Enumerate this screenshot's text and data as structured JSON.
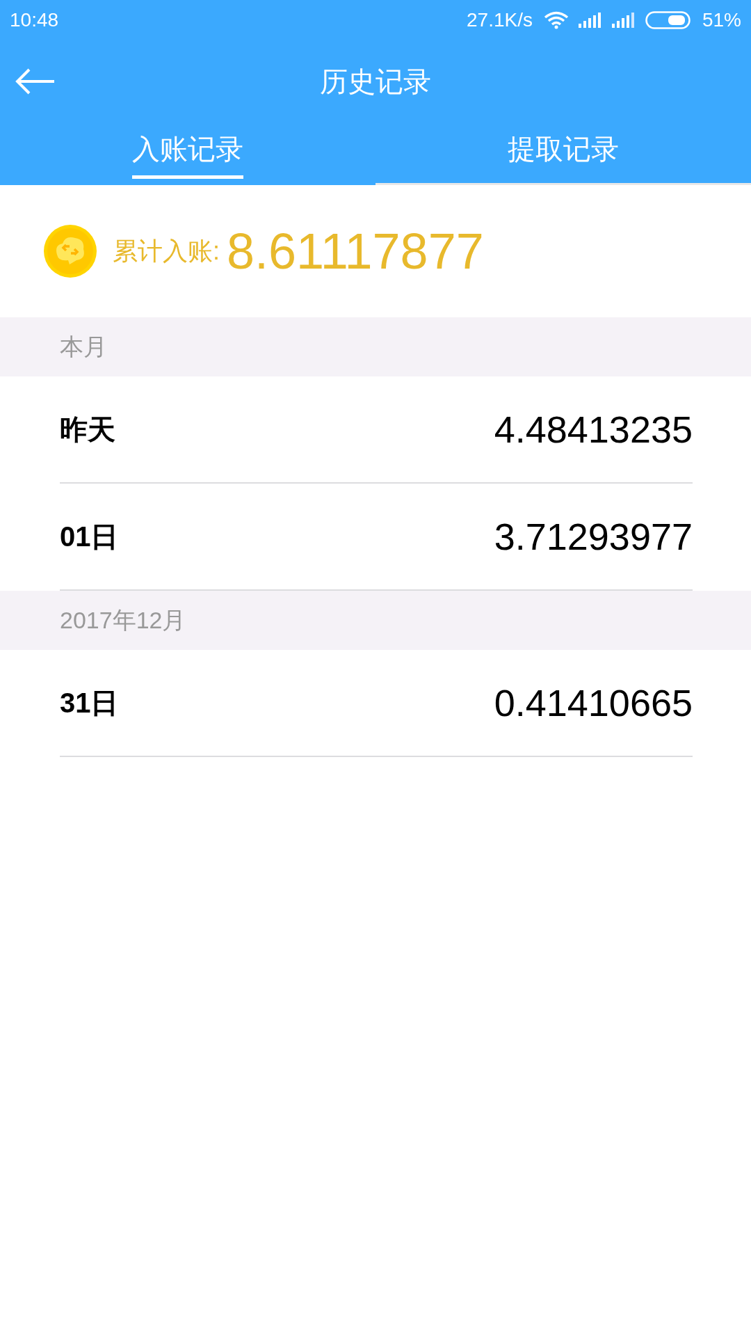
{
  "status_bar": {
    "time": "10:48",
    "net_speed": "27.1K/s",
    "battery": "51%"
  },
  "header": {
    "title": "历史记录"
  },
  "tabs": [
    {
      "label": "入账记录",
      "selected": true
    },
    {
      "label": "提取记录",
      "selected": false
    }
  ],
  "total": {
    "label": "累计入账:",
    "value": "8.61117877"
  },
  "sections": [
    {
      "title": "本月",
      "rows": [
        {
          "date": "昨天",
          "amount": "4.48413235"
        },
        {
          "date": "01日",
          "amount": "3.71293977"
        }
      ]
    },
    {
      "title": "2017年12月",
      "rows": [
        {
          "date": "31日",
          "amount": "0.41410665"
        }
      ]
    }
  ]
}
